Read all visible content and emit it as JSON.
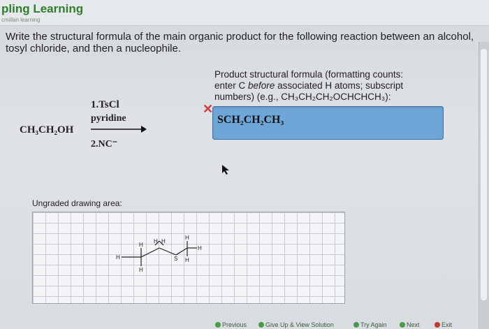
{
  "header": {
    "brand": "pling Learning",
    "brand_sub": "cmillan learning"
  },
  "question": {
    "text": "Write the structural formula of the main organic product for the following reaction between an alcohol, tosyl chloride, and then a nucleophile."
  },
  "reaction": {
    "reactant": "CH₃CH₂OH",
    "step1": "1.TsCl",
    "step1_solvent": "pyridine",
    "step2": "2.NC⁻"
  },
  "answer": {
    "instructions_line1": "Product structural formula (formatting counts:",
    "instructions_line2a": "enter C ",
    "instructions_line2b": "before",
    "instructions_line2c": " associated H atoms; subscript",
    "instructions_line3": "numbers) (e.g., CH₃CH₂CH₂OCHCHCH₃):",
    "value": "SCH₂CH₂CH₃",
    "status_icon": "x-icon",
    "status_color": "#d23a3a",
    "box_color": "#6fa6d8"
  },
  "drawing": {
    "label": "Ungraded drawing area:",
    "molecule": {
      "atoms": [
        "H",
        "H",
        "H",
        "H",
        "H",
        "S",
        "H",
        "H",
        "H"
      ]
    }
  },
  "nav": {
    "previous": "Previous",
    "give_up": "Give Up & View Solution",
    "try_again": "Try Again",
    "next": "Next",
    "exit": "Exit"
  }
}
